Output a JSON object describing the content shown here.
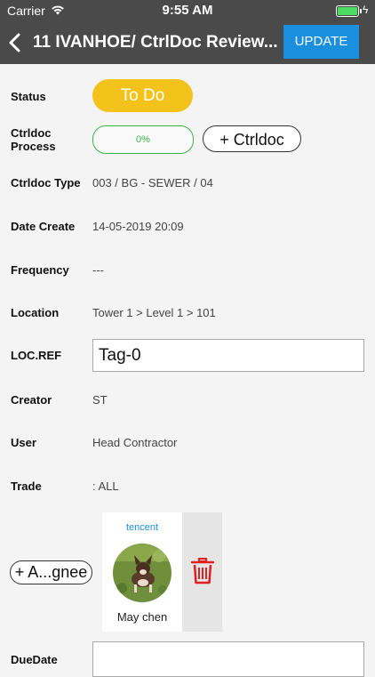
{
  "status_bar": {
    "carrier": "Carrier",
    "time": "9:55 AM"
  },
  "nav": {
    "back_icon": "chevron-left-icon",
    "title": "11 IVANHOE/ CtrlDoc Review...",
    "update_label": "UPDATE"
  },
  "status": {
    "label": "Status",
    "value": "To Do",
    "color": "#f3c21b"
  },
  "process": {
    "label_line1": "Ctrldoc",
    "label_line2": "Process",
    "progress_text": "0%",
    "progress": 0,
    "add_button": "+ Ctrldoc"
  },
  "ctrldoc_type": {
    "label": "Ctrldoc Type",
    "value": "003 / BG - SEWER / 04"
  },
  "date_create": {
    "label": "Date Create",
    "value": "14-05-2019 20:09"
  },
  "frequency": {
    "label": "Frequency",
    "value": "---"
  },
  "location": {
    "label": "Location",
    "value": "Tower 1 > Level 1 > 101"
  },
  "loc_ref": {
    "label": "LOC.REF",
    "value": "Tag-0"
  },
  "creator": {
    "label": "Creator",
    "value": "ST"
  },
  "user": {
    "label": "User",
    "value": "Head Contractor"
  },
  "trade": {
    "label": "Trade",
    "value": ": ALL"
  },
  "assignee": {
    "button": "+ A...gnee",
    "company": "tencent",
    "name": "May  chen",
    "delete_icon": "trash-icon"
  },
  "due_date": {
    "label": "DueDate",
    "value": ""
  },
  "colors": {
    "accent": "#1a8fde",
    "progress": "#3bb34a",
    "delete": "#e02020",
    "bar": "#4a4a4a"
  }
}
